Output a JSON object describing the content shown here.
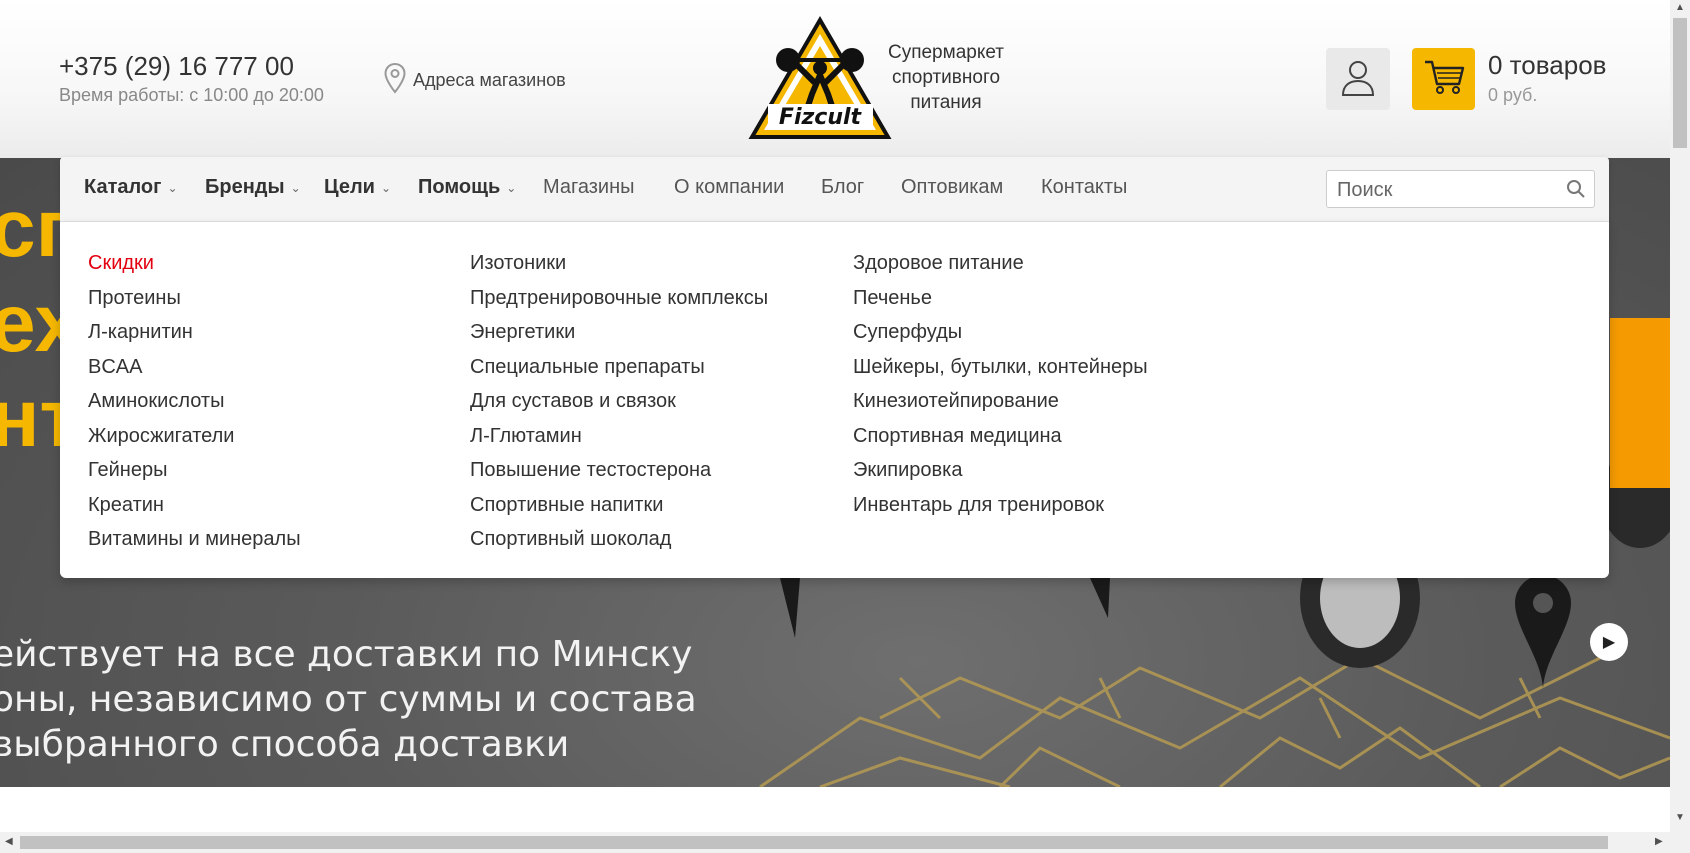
{
  "header": {
    "phone": "+375 (29) 16 777 00",
    "hours": "Время работы: с 10:00 до 20:00",
    "addresses_link": "Адреса магазинов",
    "logo_text": "Fizcult",
    "tagline_line1": "Супермаркет",
    "tagline_line2": "спортивного",
    "tagline_line3": "питания",
    "cart_count": "0 товаров",
    "cart_sum": "0 руб.",
    "icons": [
      "location-pin-icon",
      "user-icon",
      "cart-icon"
    ]
  },
  "nav": {
    "items": [
      {
        "label": "Каталог",
        "dropdown": true
      },
      {
        "label": "Бренды",
        "dropdown": true
      },
      {
        "label": "Цели",
        "dropdown": true
      },
      {
        "label": "Помощь",
        "dropdown": true
      },
      {
        "label": "Магазины",
        "dropdown": false
      },
      {
        "label": "О компании",
        "dropdown": false
      },
      {
        "label": "Блог",
        "dropdown": false
      },
      {
        "label": "Оптовикам",
        "dropdown": false
      },
      {
        "label": "Контакты",
        "dropdown": false
      }
    ],
    "search_placeholder": "Поиск"
  },
  "catalog": {
    "col1": [
      "Скидки",
      "Протеины",
      "Л-карнитин",
      "BCAA",
      "Аминокислоты",
      "Жиросжигатели",
      "Гейнеры",
      "Креатин",
      "Витамины и минералы"
    ],
    "col2": [
      "Изотоники",
      "Предтренировочные комплексы",
      "Энергетики",
      "Специальные препараты",
      "Для суставов и связок",
      "Л-Глютамин",
      "Повышение тестостерона",
      "Спортивные напитки",
      "Спортивный шоколад"
    ],
    "col3": [
      "Здоровое питание",
      "Печенье",
      "Суперфуды",
      "Шейкеры, бутылки, контейнеры",
      "Кинезиотейпирование",
      "Спортивная медицина",
      "Экипировка",
      "Инвентарь для тренировок"
    ]
  },
  "banner": {
    "line1": "ействует на все доставки по Минску",
    "line2": "оны, независимо от суммы и состава",
    "line3": " выбранного способа доставки",
    "big1": "сп",
    "big2": "ех",
    "big3": "нт"
  },
  "colors": {
    "accent": "#f5b700",
    "sale": "#e3000f"
  }
}
